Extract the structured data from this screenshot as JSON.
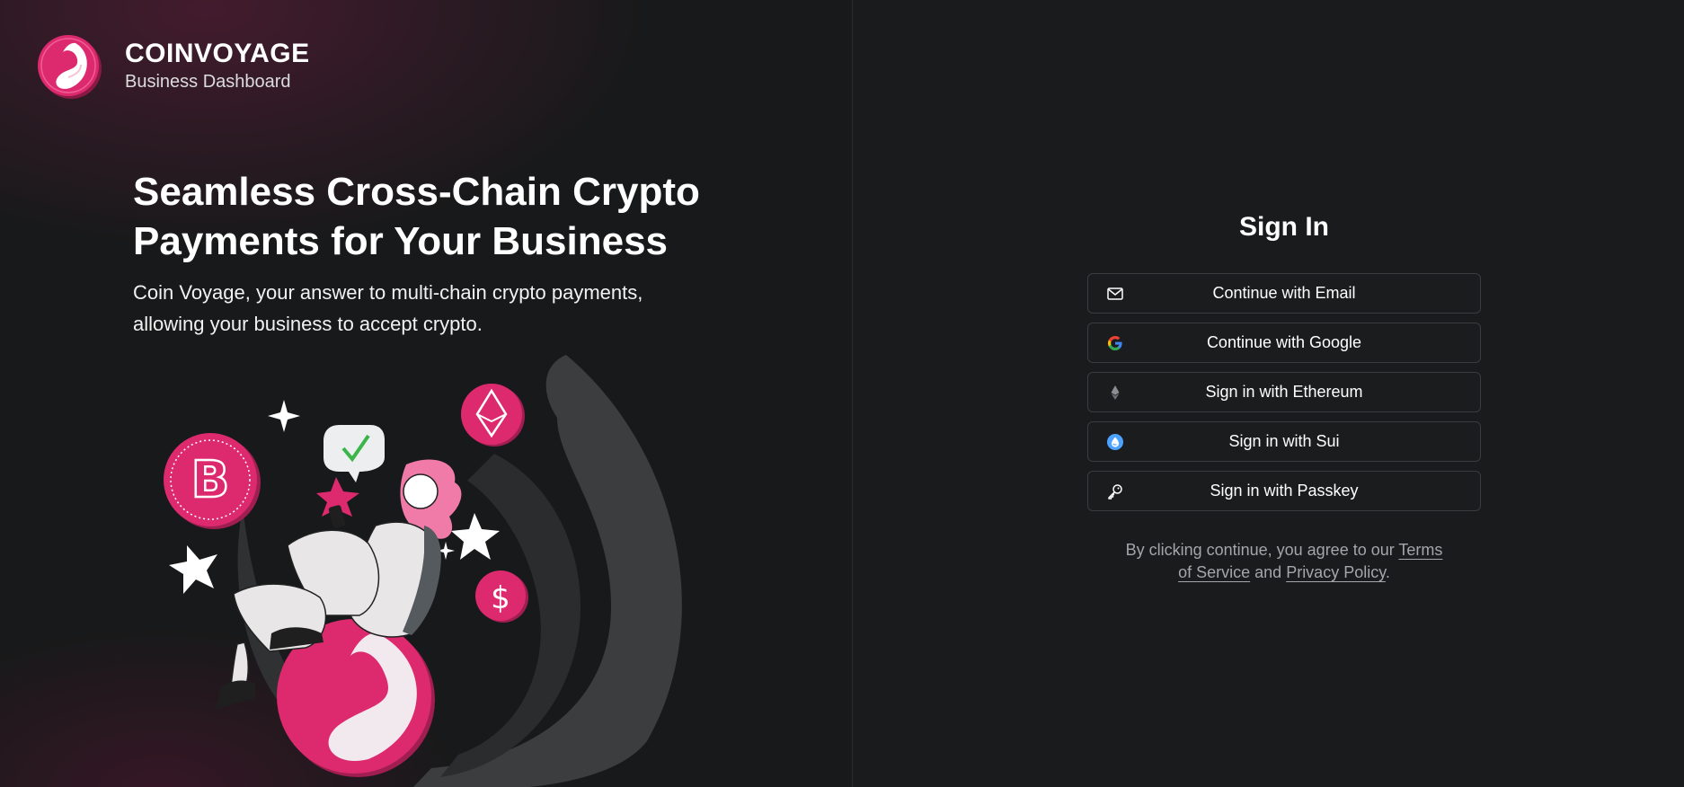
{
  "brand": {
    "name": "COINVOYAGE",
    "subtitle": "Business Dashboard",
    "logo_icon": "coinvoyage-swirl-logo",
    "accent": "#dd2a6f"
  },
  "hero": {
    "title_line1": "Seamless Cross-Chain Crypto",
    "title_line2": "Payments for Your Business",
    "desc_line1": "Coin Voyage, your answer to multi-chain crypto payments,",
    "desc_line2": "allowing your business to accept crypto."
  },
  "signin": {
    "title": "Sign In",
    "buttons": [
      {
        "label": "Continue with Email",
        "icon": "mail-icon"
      },
      {
        "label": "Continue with Google",
        "icon": "google-icon"
      },
      {
        "label": "Sign in with Ethereum",
        "icon": "ethereum-icon"
      },
      {
        "label": "Sign in with Sui",
        "icon": "sui-icon"
      },
      {
        "label": "Sign in with Passkey",
        "icon": "key-icon"
      }
    ],
    "legal": {
      "prefix": "By clicking continue, you agree to our ",
      "terms_line1": "Terms",
      "terms_line2": "of Service",
      "and": " and ",
      "privacy": "Privacy Policy",
      "suffix": "."
    }
  },
  "colors": {
    "background": "#191a1b",
    "accent_pink": "#dd2a6f",
    "button_border": "#3a3c3f",
    "legal_text": "#a3a6aa"
  }
}
